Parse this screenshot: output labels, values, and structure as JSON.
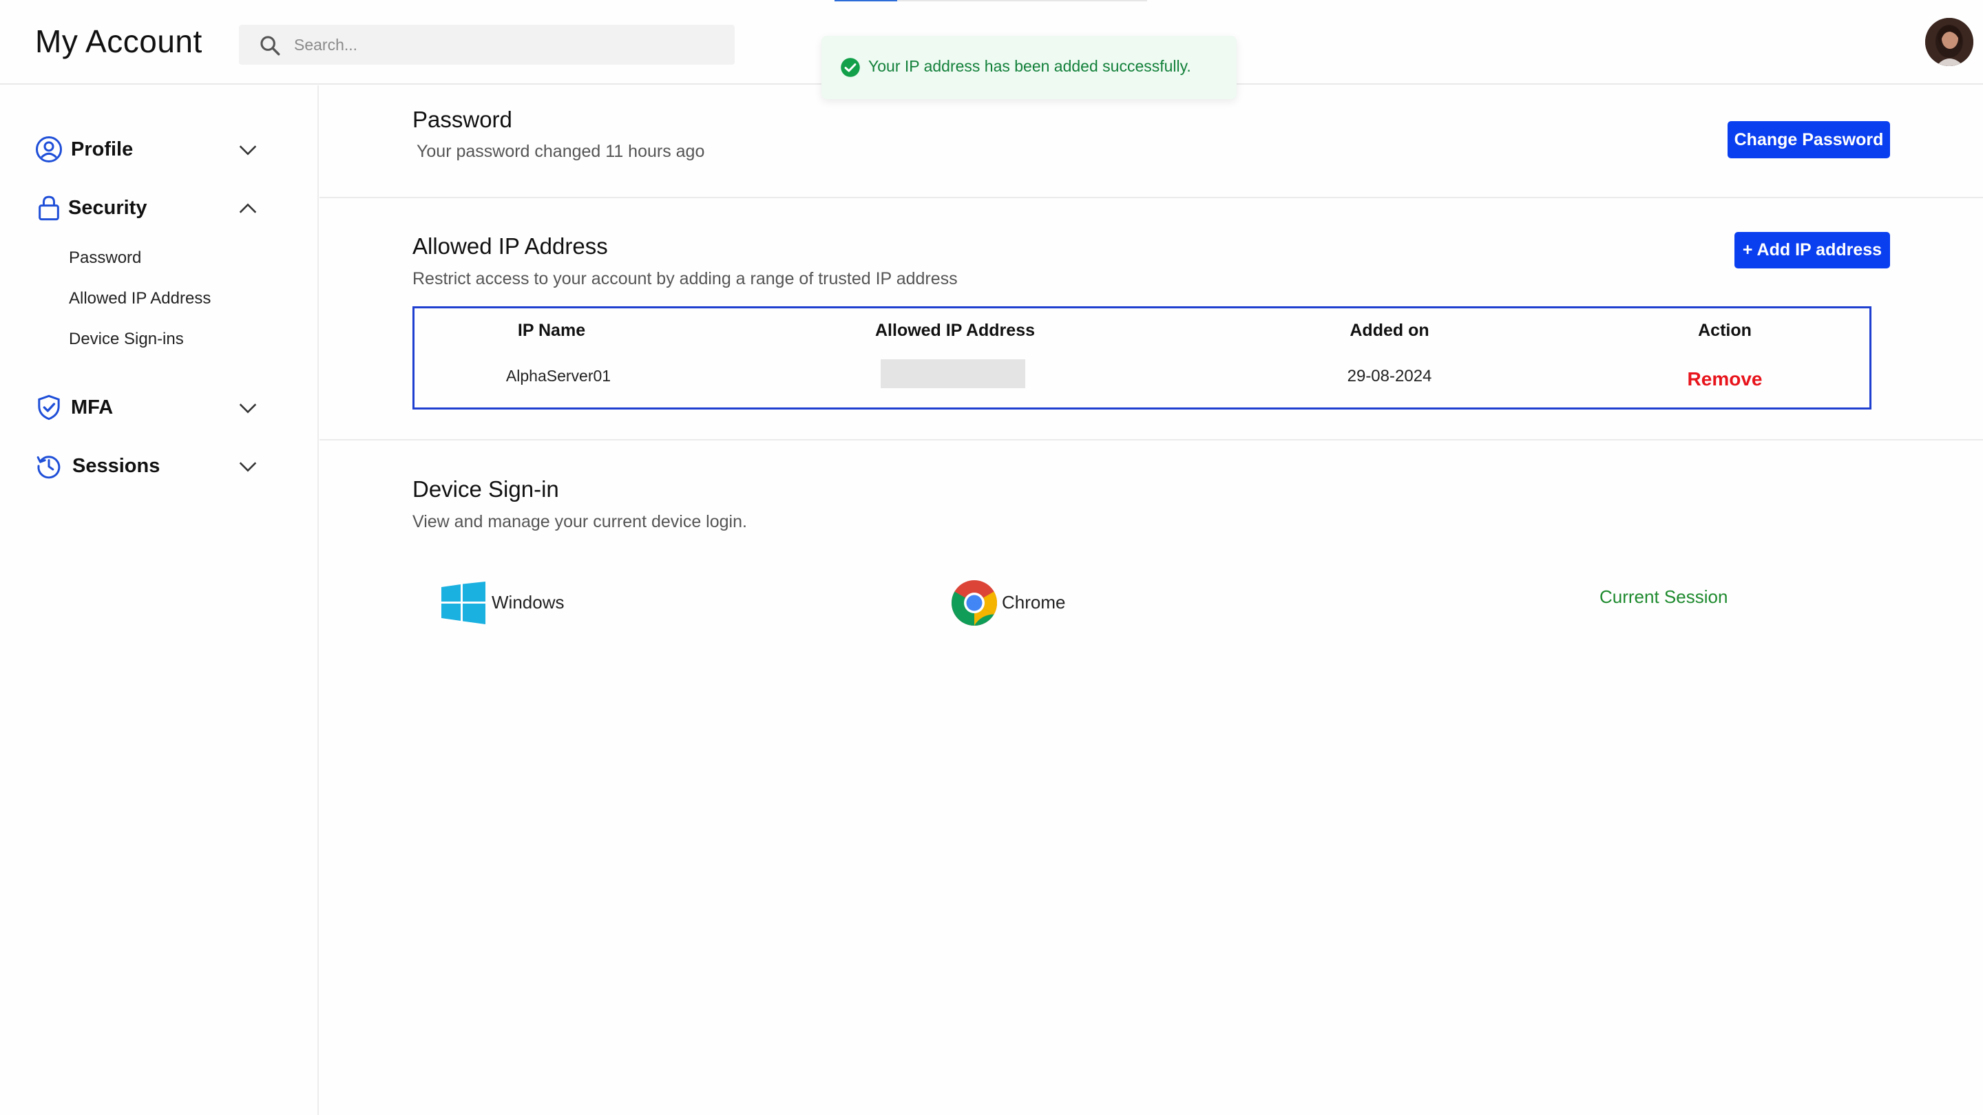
{
  "progress": 0.2,
  "header": {
    "title": "My Account",
    "search_placeholder": "Search...",
    "avatar_icon": "user-avatar"
  },
  "toast": {
    "message": "Your IP address has been added successfully.",
    "icon": "check-circle-icon",
    "color": "#13803a"
  },
  "sidebar": {
    "items": [
      {
        "label": "Profile",
        "icon": "user-circle-icon",
        "expanded": false
      },
      {
        "label": "Security",
        "icon": "lock-icon",
        "expanded": true
      },
      {
        "label": "MFA",
        "icon": "shield-check-icon",
        "expanded": false
      },
      {
        "label": "Sessions",
        "icon": "history-icon",
        "expanded": false
      }
    ],
    "security_sub": [
      "Password",
      "Allowed IP Address",
      "Device Sign-ins"
    ]
  },
  "password": {
    "title": "Password",
    "desc": "Your password changed 11 hours ago",
    "button": "Change Password"
  },
  "allowed_ip": {
    "title": "Allowed IP Address",
    "desc": "Restrict access to your account by adding a range of trusted IP address",
    "button": "+ Add IP address",
    "columns": [
      "IP Name",
      "Allowed IP Address",
      "Added on",
      "Action"
    ],
    "rows": [
      {
        "name": "AlphaServer01",
        "ip": "",
        "added_on": "29-08-2024",
        "action": "Remove"
      }
    ]
  },
  "device": {
    "title": "Device Sign-in",
    "desc": "View and manage your current device login.",
    "os": "Windows",
    "browser": "Chrome",
    "status": "Current Session"
  },
  "colors": {
    "accent": "#0a3ff0",
    "danger": "#e8141c",
    "success": "#1e8a2e",
    "table_border": "#1f3fd1"
  }
}
